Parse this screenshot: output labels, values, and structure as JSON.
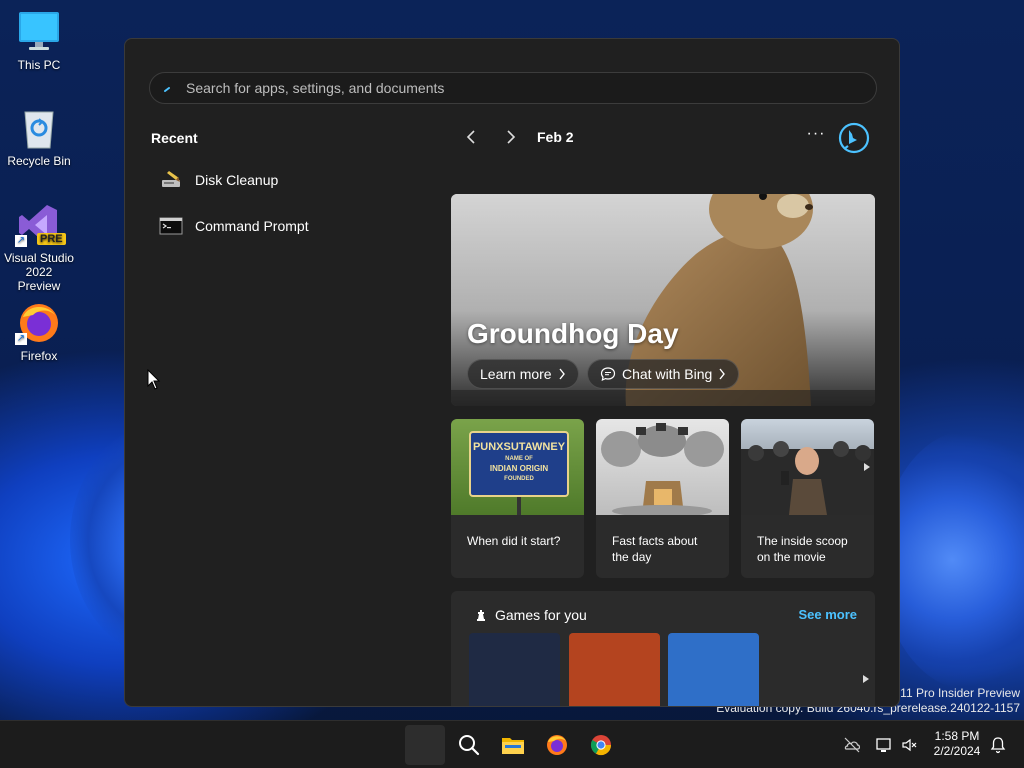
{
  "desktop": {
    "icons": [
      {
        "label": "This PC"
      },
      {
        "label": "Recycle Bin"
      },
      {
        "label": "Visual Studio 2022 Preview",
        "badge": "PRE"
      },
      {
        "label": "Firefox"
      }
    ]
  },
  "watermark": {
    "line1": "s 11 Pro Insider Preview",
    "line2": "Evaluation copy. Build 26040.rs_prerelease.240122-1157"
  },
  "start_menu": {
    "search": {
      "placeholder": "Search for apps, settings, and documents",
      "value": ""
    },
    "recent": {
      "title": "Recent",
      "items": [
        {
          "label": "Disk Cleanup",
          "icon": "disk-cleanup-icon"
        },
        {
          "label": "Command Prompt",
          "icon": "command-prompt-icon"
        }
      ]
    },
    "feed": {
      "date": "Feb 2",
      "more": "···",
      "hero": {
        "title": "Groundhog Day",
        "learn_more": "Learn more",
        "chat_with_bing": "Chat with Bing"
      },
      "cards": [
        {
          "caption": "When did it start?",
          "sign_title": "PUNXSUTAWNEY",
          "sign_sub1": "NAME OF",
          "sign_sub2": "INDIAN ORIGIN",
          "sign_sub3": "FOUNDED"
        },
        {
          "caption": "Fast facts about the day"
        },
        {
          "caption": "The inside scoop on the movie"
        }
      ],
      "games": {
        "title": "Games for you",
        "see_more": "See more",
        "tile_colors": [
          "#1f2a44",
          "#b4441f",
          "#2f6fc8"
        ]
      }
    }
  },
  "taskbar": {
    "clock_time": "1:58 PM",
    "clock_date": "2/2/2024"
  },
  "colors": {
    "accent": "#4cc2ff",
    "start_bg": "#202020",
    "card_bg": "#2b2b2b"
  }
}
